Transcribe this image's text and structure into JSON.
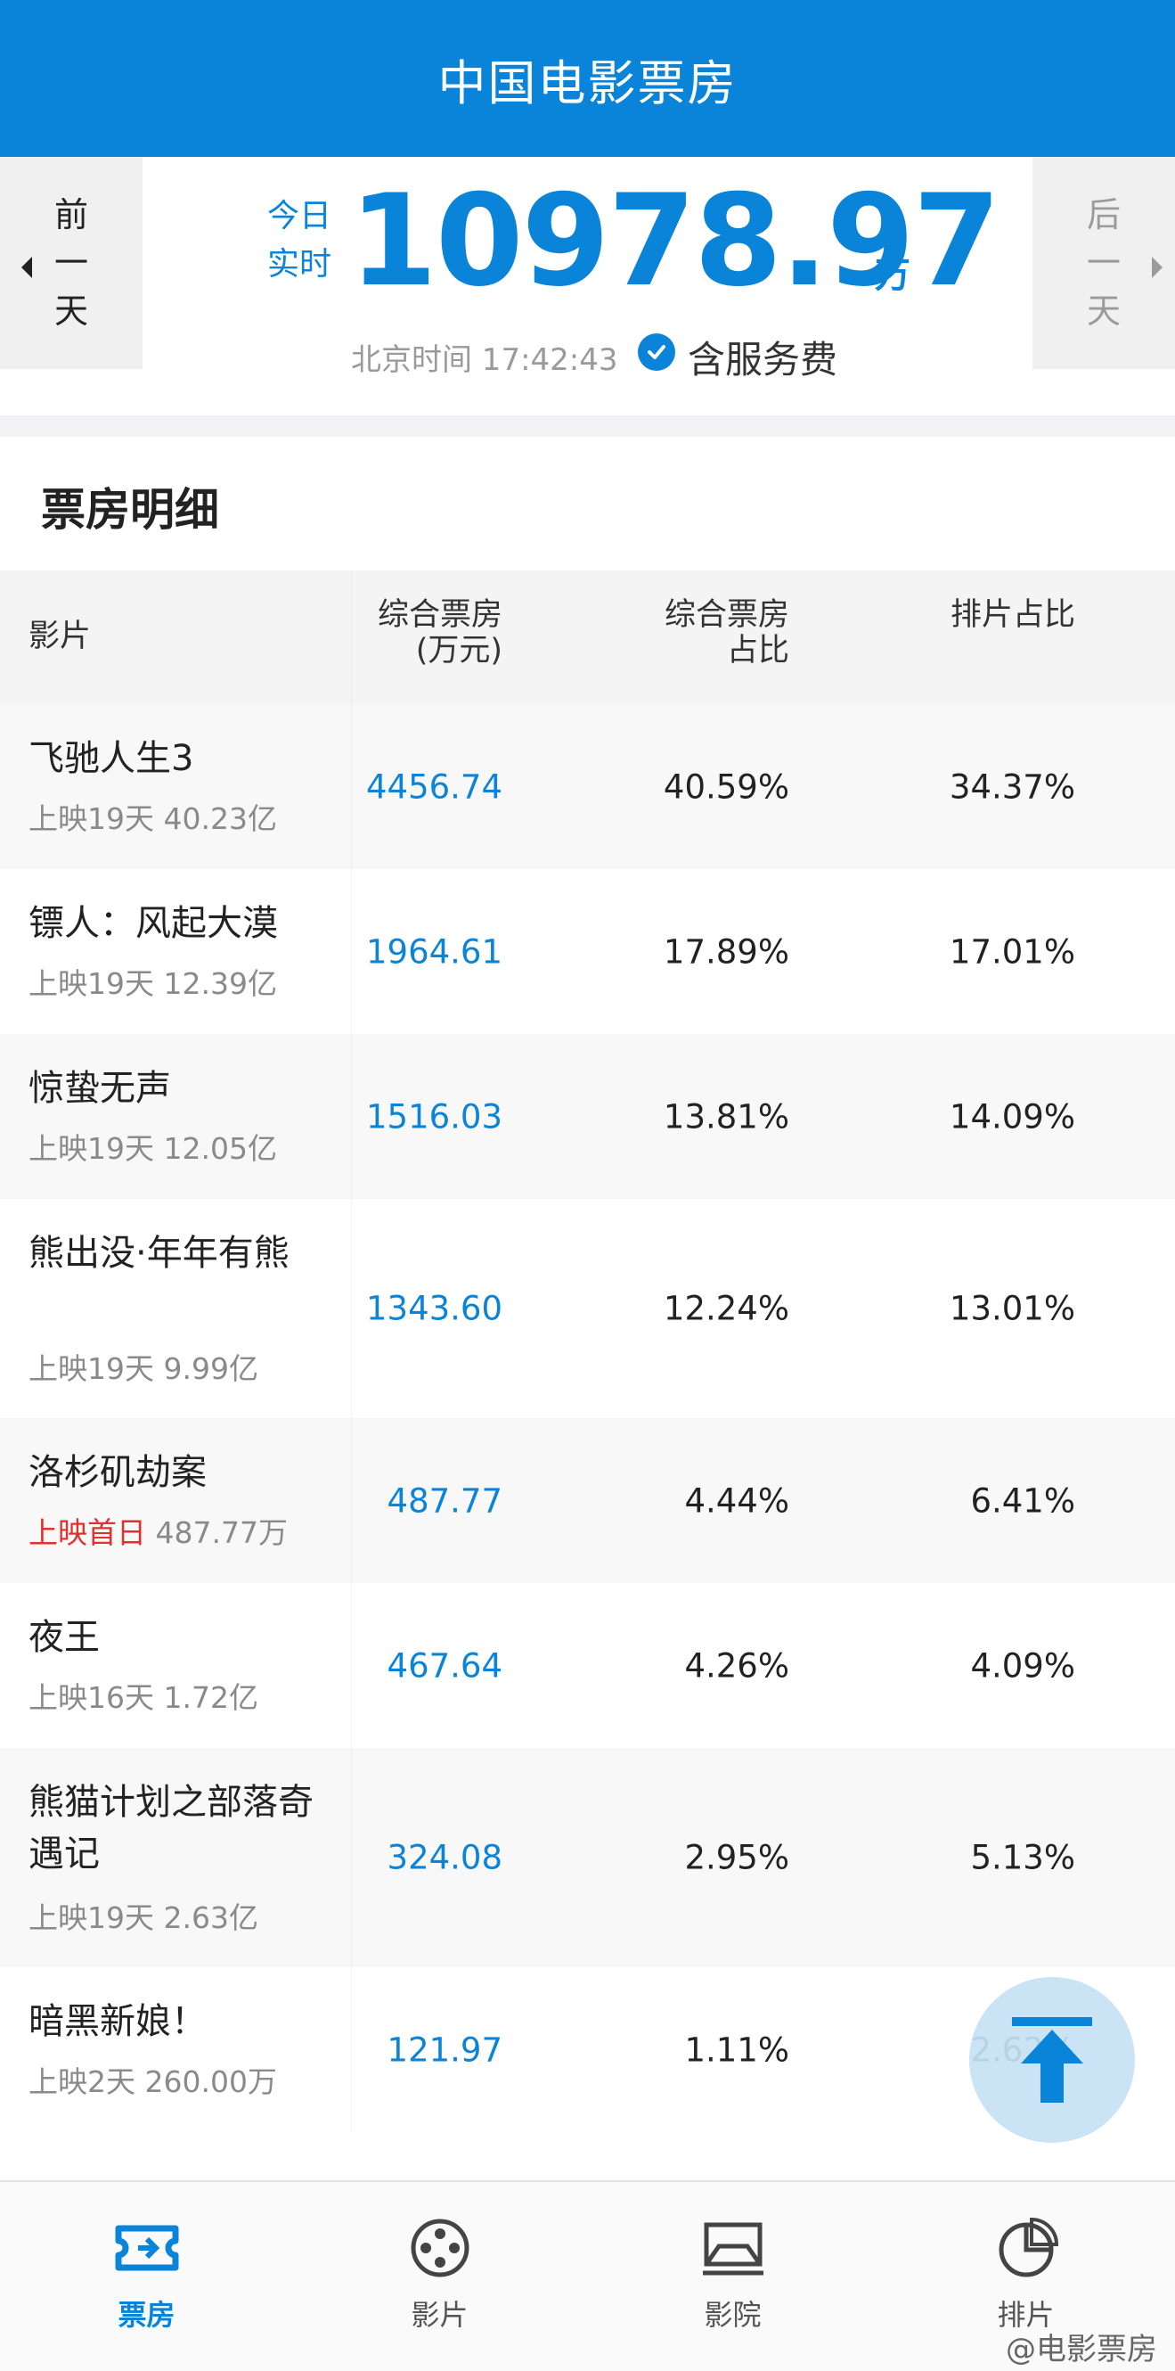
{
  "header": {
    "title": "中国电影票房"
  },
  "summary": {
    "prev_day": "前一天",
    "next_day": "后一天",
    "today_label": "今日实时",
    "total": "10978.97",
    "unit": "万",
    "beijing_time": "北京时间 17:42:43",
    "service_fee": "含服务费"
  },
  "detail": {
    "title": "票房明细",
    "headers": {
      "movie": "影片",
      "box": "综合票房\n(万元)",
      "box_share": "综合票房\n占比",
      "schedule_share": "排片占比"
    },
    "rows": [
      {
        "name": "飞驰人生3",
        "days": "上映19天",
        "total": "40.23亿",
        "box": "4456.74",
        "box_share": "40.59%",
        "schedule_share": "34.37%"
      },
      {
        "name": "镖人：风起大漠",
        "days": "上映19天",
        "total": "12.39亿",
        "box": "1964.61",
        "box_share": "17.89%",
        "schedule_share": "17.01%"
      },
      {
        "name": "惊蛰无声",
        "days": "上映19天",
        "total": "12.05亿",
        "box": "1516.03",
        "box_share": "13.81%",
        "schedule_share": "14.09%"
      },
      {
        "name": "熊出没·年年有熊",
        "days": "上映19天",
        "total": "9.99亿",
        "box": "1343.60",
        "box_share": "12.24%",
        "schedule_share": "13.01%"
      },
      {
        "name": "洛杉矶劫案",
        "days": "上映首日",
        "total": "487.77万",
        "box": "487.77",
        "box_share": "4.44%",
        "schedule_share": "6.41%"
      },
      {
        "name": "夜王",
        "days": "上映16天",
        "total": "1.72亿",
        "box": "467.64",
        "box_share": "4.26%",
        "schedule_share": "4.09%"
      },
      {
        "name": "熊猫计划之部落奇遇记",
        "days": "上映19天",
        "total": "2.63亿",
        "box": "324.08",
        "box_share": "2.95%",
        "schedule_share": "5.13%"
      },
      {
        "name": "暗黑新娘！",
        "days": "上映2天",
        "total": "260.00万",
        "box": "121.97",
        "box_share": "1.11%",
        "schedule_share": "2.62%"
      }
    ]
  },
  "tabbar": {
    "items": [
      {
        "label": "票房",
        "icon": "ticket-icon"
      },
      {
        "label": "影片",
        "icon": "film-reel-icon"
      },
      {
        "label": "影院",
        "icon": "cinema-screen-icon"
      },
      {
        "label": "排片",
        "icon": "pie-chart-icon"
      }
    ]
  },
  "watermark": "@电影票房",
  "colors": {
    "accent": "#0a84d8",
    "first_day_red": "#e0312f"
  }
}
